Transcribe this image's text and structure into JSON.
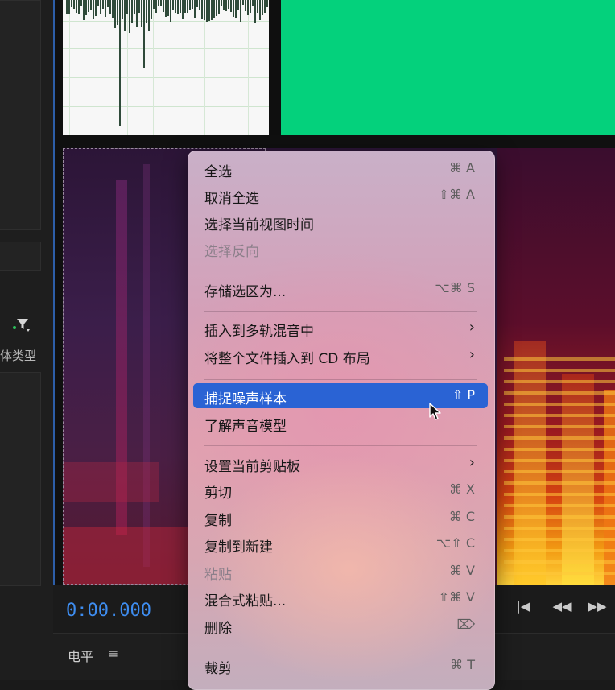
{
  "left_panel": {
    "filter_label": "体类型"
  },
  "editor": {
    "time": "0:00.000"
  },
  "bottom_panel": {
    "title": "电平",
    "menu_glyph": "≡"
  },
  "transport": {
    "to_start_glyph": "|◀",
    "rewind_glyph": "◀◀",
    "forward_glyph": "▶▶"
  },
  "context_menu": {
    "items": [
      {
        "label": "全选",
        "shortcut": "⌘ A",
        "disabled": false
      },
      {
        "label": "取消全选",
        "shortcut": "⇧⌘ A",
        "disabled": false
      },
      {
        "label": "选择当前视图时间",
        "shortcut": "",
        "disabled": false
      },
      {
        "label": "选择反向",
        "shortcut": "",
        "disabled": true
      },
      {
        "label": "存储选区为...",
        "shortcut": "⌥⌘ S",
        "disabled": false
      },
      {
        "label": "插入到多轨混音中",
        "shortcut": "",
        "submenu": true,
        "disabled": false
      },
      {
        "label": "将整个文件插入到 CD 布局",
        "shortcut": "",
        "submenu": true,
        "disabled": false
      },
      {
        "label": "捕捉噪声样本",
        "shortcut": "⇧ P",
        "disabled": false,
        "highlighted": true
      },
      {
        "label": "了解声音模型",
        "shortcut": "",
        "disabled": false
      },
      {
        "label": "设置当前剪贴板",
        "shortcut": "",
        "submenu": true,
        "disabled": false
      },
      {
        "label": "剪切",
        "shortcut": "⌘ X",
        "disabled": false
      },
      {
        "label": "复制",
        "shortcut": "⌘ C",
        "disabled": false
      },
      {
        "label": "复制到新建",
        "shortcut": "⌥⇧ C",
        "disabled": false
      },
      {
        "label": "粘贴",
        "shortcut": "⌘ V",
        "disabled": true
      },
      {
        "label": "混合式粘贴...",
        "shortcut": "⇧⌘ V",
        "disabled": false
      },
      {
        "label": "删除",
        "shortcut": "⌦",
        "disabled": false
      },
      {
        "label": "裁剪",
        "shortcut": "⌘ T",
        "disabled": false
      }
    ],
    "submenu_arrow": "›"
  },
  "colors": {
    "highlight": "#2a63d4",
    "waveform_green": "#04d17c",
    "time_blue": "#3e8df0"
  }
}
